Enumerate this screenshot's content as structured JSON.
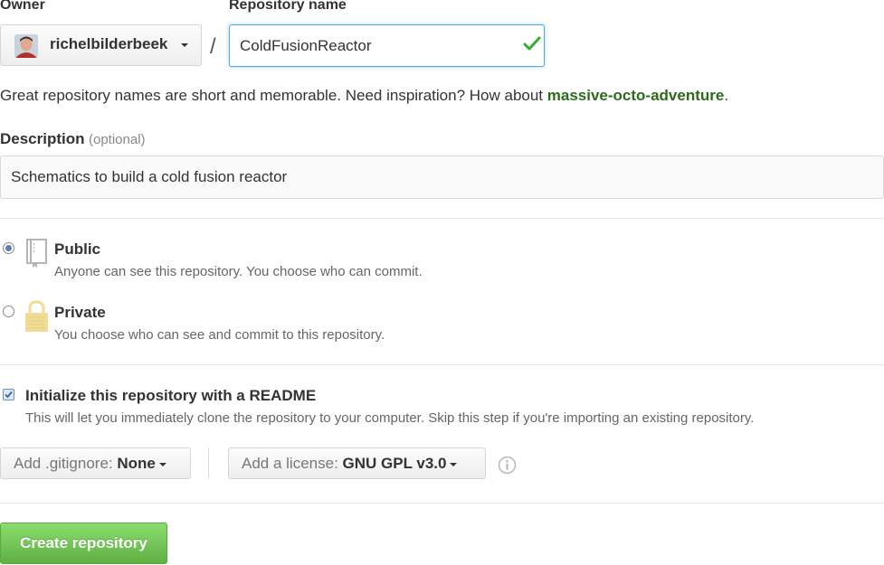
{
  "owner": {
    "label": "Owner",
    "username": "richelbilderbeek"
  },
  "separator": "/",
  "repo": {
    "label": "Repository name",
    "value": "ColdFusionReactor"
  },
  "hint": {
    "text": "Great repository names are short and memorable. Need inspiration? How about ",
    "suggestion": "massive-octo-adventure",
    "end": "."
  },
  "description": {
    "label": "Description",
    "optional": "(optional)",
    "value": "Schematics to build a cold fusion reactor"
  },
  "visibility": {
    "public": {
      "title": "Public",
      "desc": "Anyone can see this repository. You choose who can commit.",
      "selected": true
    },
    "private": {
      "title": "Private",
      "desc": "You choose who can see and commit to this repository.",
      "selected": false
    }
  },
  "readme": {
    "title": "Initialize this repository with a README",
    "desc": "This will let you immediately clone the repository to your computer. Skip this step if you're importing an existing repository.",
    "checked": true
  },
  "gitignore": {
    "prefix": "Add .gitignore:",
    "value": "None"
  },
  "license": {
    "prefix": "Add a license:",
    "value": "GNU GPL v3.0"
  },
  "submit": {
    "label": "Create repository"
  },
  "colors": {
    "accent_green": "#60b044",
    "link_green": "#2c6b1a",
    "check_green": "#30b030",
    "focus_blue": "#51a7e8"
  }
}
